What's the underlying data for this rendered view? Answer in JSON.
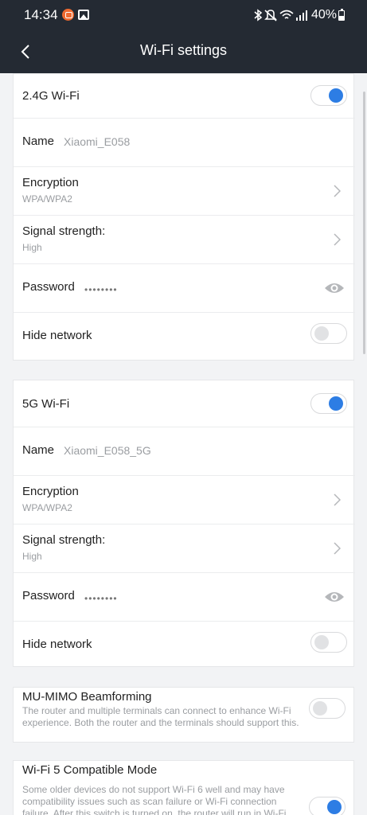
{
  "status_bar": {
    "time": "14:34",
    "battery": "40%"
  },
  "header": {
    "title": "Wi-Fi settings"
  },
  "band_24": {
    "title": "2.4G Wi-Fi",
    "enabled": true,
    "name_label": "Name",
    "name_value": "Xiaomi_E058",
    "encryption_label": "Encryption",
    "encryption_value": "WPA/WPA2",
    "signal_label": "Signal strength:",
    "signal_value": "High",
    "password_label": "Password",
    "password_value": "••••••••",
    "hide_label": "Hide network",
    "hide_enabled": false
  },
  "band_5": {
    "title": "5G Wi-Fi",
    "enabled": true,
    "name_label": "Name",
    "name_value": "Xiaomi_E058_5G",
    "encryption_label": "Encryption",
    "encryption_value": "WPA/WPA2",
    "signal_label": "Signal strength:",
    "signal_value": "High",
    "password_label": "Password",
    "password_value": "••••••••",
    "hide_label": "Hide network",
    "hide_enabled": false
  },
  "mumimo": {
    "title": "MU-MIMO Beamforming",
    "description": "The router and multiple terminals can connect to enhance Wi-Fi experience. Both the router and the terminals should support this.",
    "enabled": false
  },
  "wifi5": {
    "title": "Wi-Fi 5 Compatible Mode",
    "description": "Some older devices do not support Wi-Fi 6 well and may have compatibility issues such as scan failure or Wi-Fi connection failure. After this switch is turned on, the router will run in Wi-Fi",
    "enabled": true
  },
  "colors": {
    "header_bg": "#242a33",
    "accent": "#2d7de4",
    "page_bg": "#f2f3f5"
  },
  "icons": [
    "back-arrow-icon",
    "chevron-right-icon",
    "eye-icon",
    "bluetooth-icon",
    "mute-icon",
    "wifi-icon",
    "signal-icon",
    "battery-icon"
  ]
}
